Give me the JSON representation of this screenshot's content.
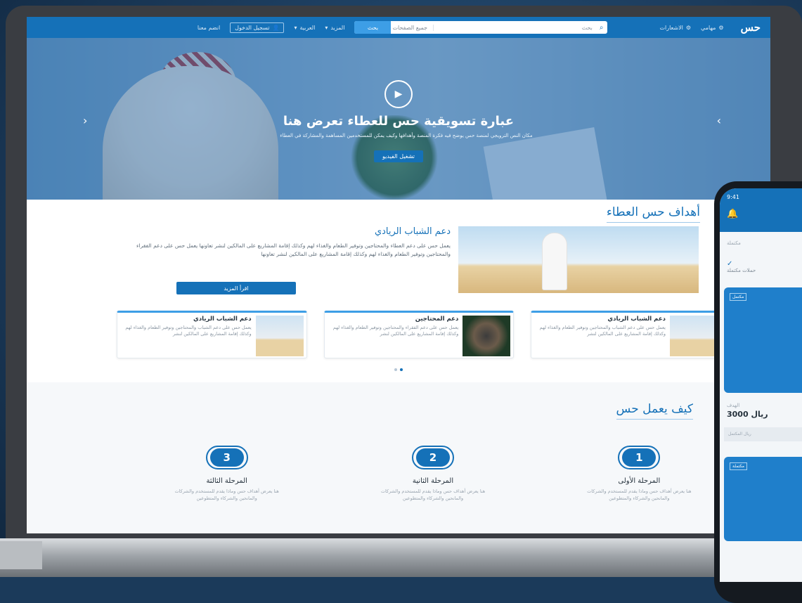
{
  "topbar": {
    "logo": "حس",
    "link_tasks": "مهامي",
    "link_notifications": "الاشعارات",
    "search_category": "جميع الصفحات",
    "search_placeholder": "بحث",
    "search_button": "بحث",
    "lang": "العربية",
    "dropdown_more": "المزيد",
    "register_label": "تسجيل الدخول",
    "join_label": "انضم معنا"
  },
  "hero": {
    "title": "عبارة تسويقية حس للعطاء تعرض هنا",
    "subtitle": "مكان النص الترويجي لمنصة حس يوضح فيه فكرة المنصة وأهدافها وكيف يمكن للمستخدمين المساهمة والمشاركة في العطاء",
    "button": "تشغيل الفيديو"
  },
  "goals": {
    "section_title": "أهداف حس العطاء",
    "feature_title": "دعم الشباب الريادي",
    "feature_text": "يعمل حس على دعم العطاء والمحتاجين وتوفير الطعام والغذاء لهم وكذلك إقامة المشاريع على المالكين لنشر تعاونها يعمل حس على دعم الفقراء والمحتاجين وتوفير الطعام والغذاء لهم وكذلك إقامة المشاريع على المالكين لنشر تعاونها",
    "feature_button": "اقرأ المزيد",
    "cards": [
      {
        "title": "دعم الشباب الريادي",
        "text": "يعمل حس على دعم الشباب والمحتاجين وتوفير الطعام والغذاء لهم وكذلك إقامة المشاريع على المالكين لنشر"
      },
      {
        "title": "دعم المحتاجين",
        "text": "يعمل حس على دعم الفقراء والمحتاجين وتوفير الطعام والغذاء لهم وكذلك إقامة المشاريع على المالكين لنشر"
      },
      {
        "title": "دعم الشباب الريادي",
        "text": "يعمل حس على دعم الشباب والمحتاجين وتوفير الطعام والغذاء لهم وكذلك إقامة المشاريع على المالكين لنشر"
      }
    ]
  },
  "how": {
    "section_title": "كيف يعمل حس",
    "steps": [
      {
        "num": "1",
        "title": "المرحلة الأولى",
        "text": "هنا يعرض أهداف حس وماذا يقدم للمستخدم والشركات والمانحين والشركاء والمتطوعين"
      },
      {
        "num": "2",
        "title": "المرحلة الثانية",
        "text": "هنا يعرض أهداف حس وماذا يقدم للمستخدم والشركات والمانحين والشركاء والمتطوعين"
      },
      {
        "num": "3",
        "title": "المرحلة الثالثة",
        "text": "هنا يعرض أهداف حس وماذا يقدم للمستخدم والشركات والمانحين والشركاء والمتطوعين"
      }
    ]
  },
  "phone": {
    "time": "9:41",
    "tab": "مكتملة",
    "stat_label": "حملات مكتملة",
    "card_badge": "مكتمل",
    "target_label": "الهدف",
    "amount": "3000 ريال",
    "bar_text": "ريال المكتمل",
    "card2_badge": "مكتملة"
  },
  "colors": {
    "brand": "#1571b8",
    "accent": "#3d9ee6"
  }
}
